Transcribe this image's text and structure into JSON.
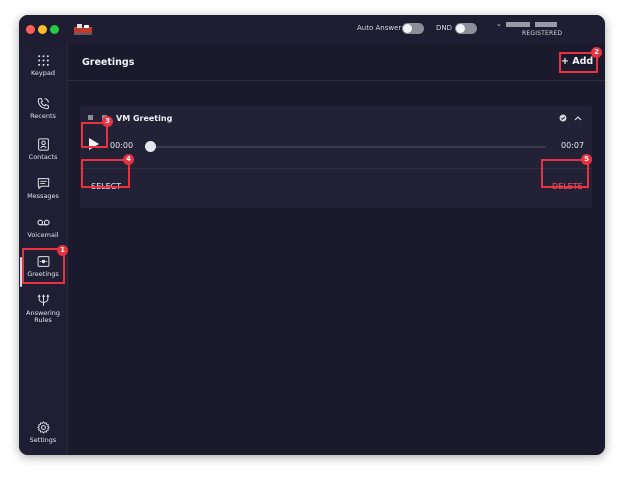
{
  "titlebar": {
    "auto_answer_label": "Auto Answer",
    "dnd_label": "DND",
    "registration_status": "REGISTERED"
  },
  "sidebar": {
    "items": [
      {
        "label": "Keypad",
        "icon": "keypad-icon"
      },
      {
        "label": "Recents",
        "icon": "recents-icon"
      },
      {
        "label": "Contacts",
        "icon": "contacts-icon"
      },
      {
        "label": "Messages",
        "icon": "messages-icon"
      },
      {
        "label": "Voicemail",
        "icon": "voicemail-icon"
      },
      {
        "label": "Greetings",
        "icon": "greetings-icon",
        "active": true
      },
      {
        "label": "Answering Rules",
        "icon": "answering-rules-icon"
      },
      {
        "label": "Settings",
        "icon": "settings-icon"
      }
    ]
  },
  "main": {
    "title": "Greetings",
    "add_label": "+ Add"
  },
  "greeting": {
    "name": "VM Greeting",
    "time_start": "00:00",
    "time_end": "00:07",
    "select_label": "SELECT",
    "delete_label": "DELETE",
    "progress": 0
  },
  "annotations": [
    "1",
    "2",
    "3",
    "4",
    "5"
  ],
  "colors": {
    "background": "#1b1a2d",
    "sidebar": "#1f1e33",
    "card": "#222136",
    "delete": "#ff5a64",
    "highlight": "#e8323f"
  }
}
